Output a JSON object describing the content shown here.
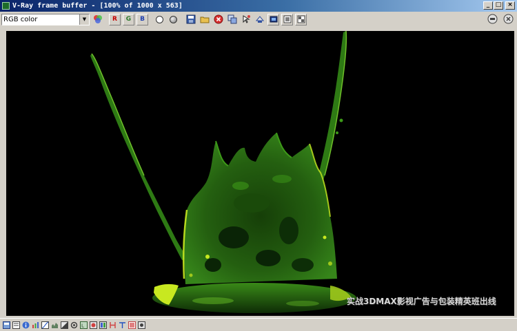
{
  "window": {
    "title": "V-Ray frame buffer - [100% of 1000 x 563]",
    "title_buttons": [
      "_",
      "□",
      "×"
    ]
  },
  "toolbar": {
    "channel_select_value": "RGB color",
    "channel_buttons": [
      "R",
      "G",
      "B"
    ],
    "icons": [
      "color-swatch-icon",
      "red-channel-icon",
      "green-channel-icon",
      "blue-channel-icon",
      "white-circle-icon",
      "mono-circle-icon",
      "save-icon",
      "open-icon",
      "clear-icon",
      "duplicate-icon",
      "track-mouse-icon",
      "region-render-icon",
      "link-icon",
      "show-corrections-icon",
      "lut-icon",
      "pixel-aspect-icon"
    ],
    "right_icons": [
      "render-icon",
      "stop-icon"
    ]
  },
  "render": {
    "watermark_text": "实战3DMAX影视广告与包装精英班出线",
    "background_color": "#000000",
    "liquid_colors": [
      "#1e5a0c",
      "#2e7a14",
      "#3d9a18",
      "#c8e820",
      "#0c2e06"
    ]
  },
  "bottombar": {
    "icons": [
      "history-icon",
      "info-icon",
      "info-circle-icon",
      "levels-icon",
      "curve-icon",
      "histogram-icon",
      "exposure-icon",
      "settings-icon",
      "lut-toggle-icon",
      "srgb-icon",
      "ocio-icon",
      "compare-h-icon",
      "compare-v-icon",
      "stamp-icon",
      "lens-icon"
    ]
  }
}
